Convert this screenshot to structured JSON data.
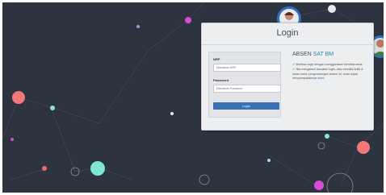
{
  "login": {
    "title": "Login",
    "nrp_label": "NRP",
    "nrp_placeholder": "Masukkan NRP",
    "password_label": "Password",
    "password_placeholder": "Masukkan Password",
    "button_label": "Login"
  },
  "info": {
    "brand_prefix": "ABSEN ",
    "brand_suffix": "SAT BM",
    "check_icon": "✔",
    "line1": "Silahkan login dengan menggunakan identitas anda",
    "line2_before_link": "Jika mengalami kesulitan login, atau memiliki kritik & saran untuk pengembangan sistem ini, anda dapat menyampaikannya ",
    "link_text": "disini"
  },
  "colors": {
    "background": "#2d3440",
    "panel": "#eceef0",
    "button": "#3772b3",
    "accent": "#2b8aa8"
  },
  "icons": [
    "avatar-icon",
    "check-icon"
  ]
}
